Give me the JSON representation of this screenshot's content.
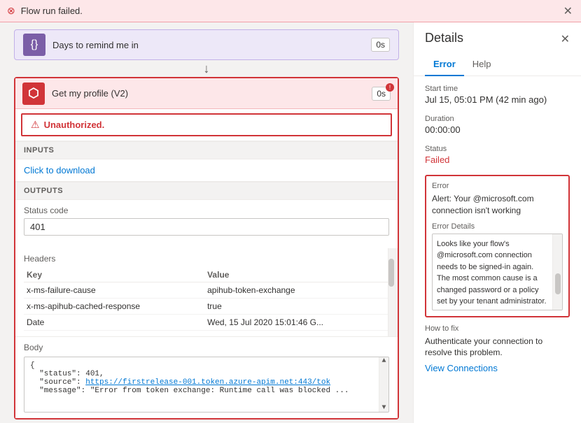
{
  "banner": {
    "text": "Flow run failed.",
    "error_icon": "⊗",
    "close_icon": "✕"
  },
  "flow": {
    "step_days": {
      "label": "Days to remind me in",
      "duration": "0s",
      "icon": "{}"
    },
    "step_profile": {
      "label": "Get my profile (V2)",
      "duration": "0s",
      "unauthorized_text": "Unauthorized.",
      "inputs_header": "INPUTS",
      "click_to_download": "Click to download",
      "outputs_header": "OUTPUTS",
      "status_code_label": "Status code",
      "status_code_value": "401",
      "headers_label": "Headers",
      "headers_col_key": "Key",
      "headers_col_value": "Value",
      "headers_rows": [
        {
          "key": "x-ms-failure-cause",
          "value": "apihub-token-exchange"
        },
        {
          "key": "x-ms-apihub-cached-response",
          "value": "true"
        },
        {
          "key": "Date",
          "value": "Wed, 15 Jul 2020 15:01:46 G..."
        }
      ],
      "body_label": "Body",
      "body_lines": [
        "{",
        "  \"status\": 401,",
        "  \"source\": \"https://firstrelease-001.token.azure-apim.net:443/tok",
        "  \"message\": \"Error from token exchange: Runtime call was blocked ..."
      ]
    }
  },
  "details": {
    "title": "Details",
    "close_icon": "✕",
    "tabs": [
      "Error",
      "Help"
    ],
    "active_tab": "Error",
    "start_time_label": "Start time",
    "start_time_value": "Jul 15, 05:01 PM (42 min ago)",
    "duration_label": "Duration",
    "duration_value": "00:00:00",
    "status_label": "Status",
    "status_value": "Failed",
    "error_label": "Error",
    "error_alert": "Alert: Your     @microsoft.com connection isn't working",
    "error_details_label": "Error Details",
    "error_details_text": "Looks like your flow's @microsoft.com connection needs to be signed-in again. The most common cause is a changed password or a policy set by your tenant administrator. Connections may also require reauthentication. if multi-factor authentication has been recently",
    "how_to_fix_label": "How to fix",
    "how_to_fix_text": "Authenticate your connection to resolve this problem.",
    "view_connections_label": "View Connections"
  }
}
